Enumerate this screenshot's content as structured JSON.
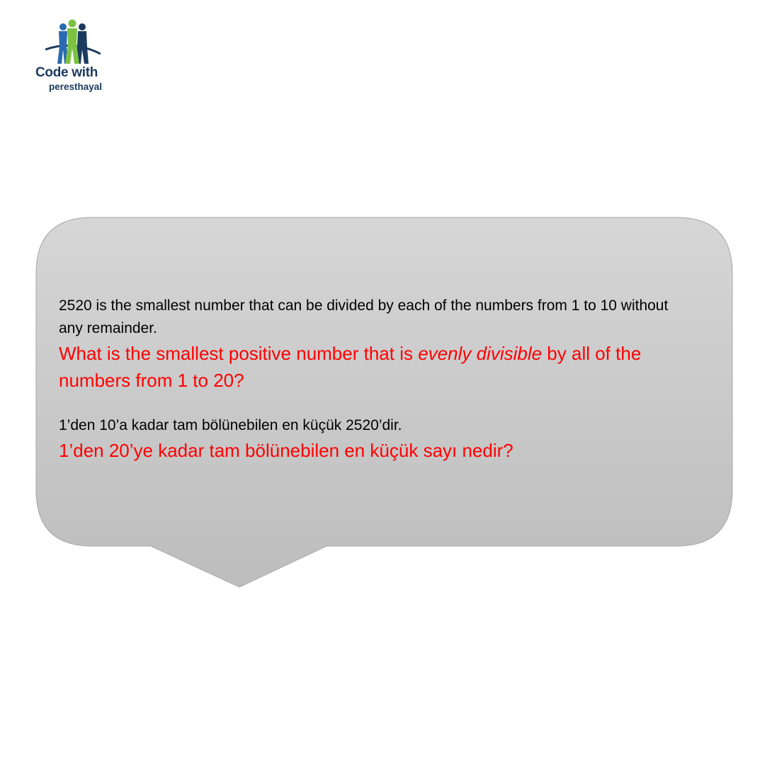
{
  "logo": {
    "line1": "Code with",
    "line2": "peresthayal",
    "icon": "people-figures-logo",
    "colors": {
      "navy": "#1c3a5e",
      "blue": "#2a6ab0",
      "green": "#7cc242"
    }
  },
  "bubble": {
    "fill": "#c9c9c9",
    "en_intro": "2520 is the smallest number that can be divided by each of the numbers from 1 to 10 without any remainder.",
    "en_q_part1": "What is the smallest positive number that is ",
    "en_q_emph": "evenly divisible",
    "en_q_part2": " by all of the numbers from 1 to 20?",
    "tr_intro": "1’den 10’a kadar tam bölünebilen en küçük 2520’dir.",
    "tr_question": "1’den 20’ye kadar tam bölünebilen en küçük sayı nedir?"
  }
}
